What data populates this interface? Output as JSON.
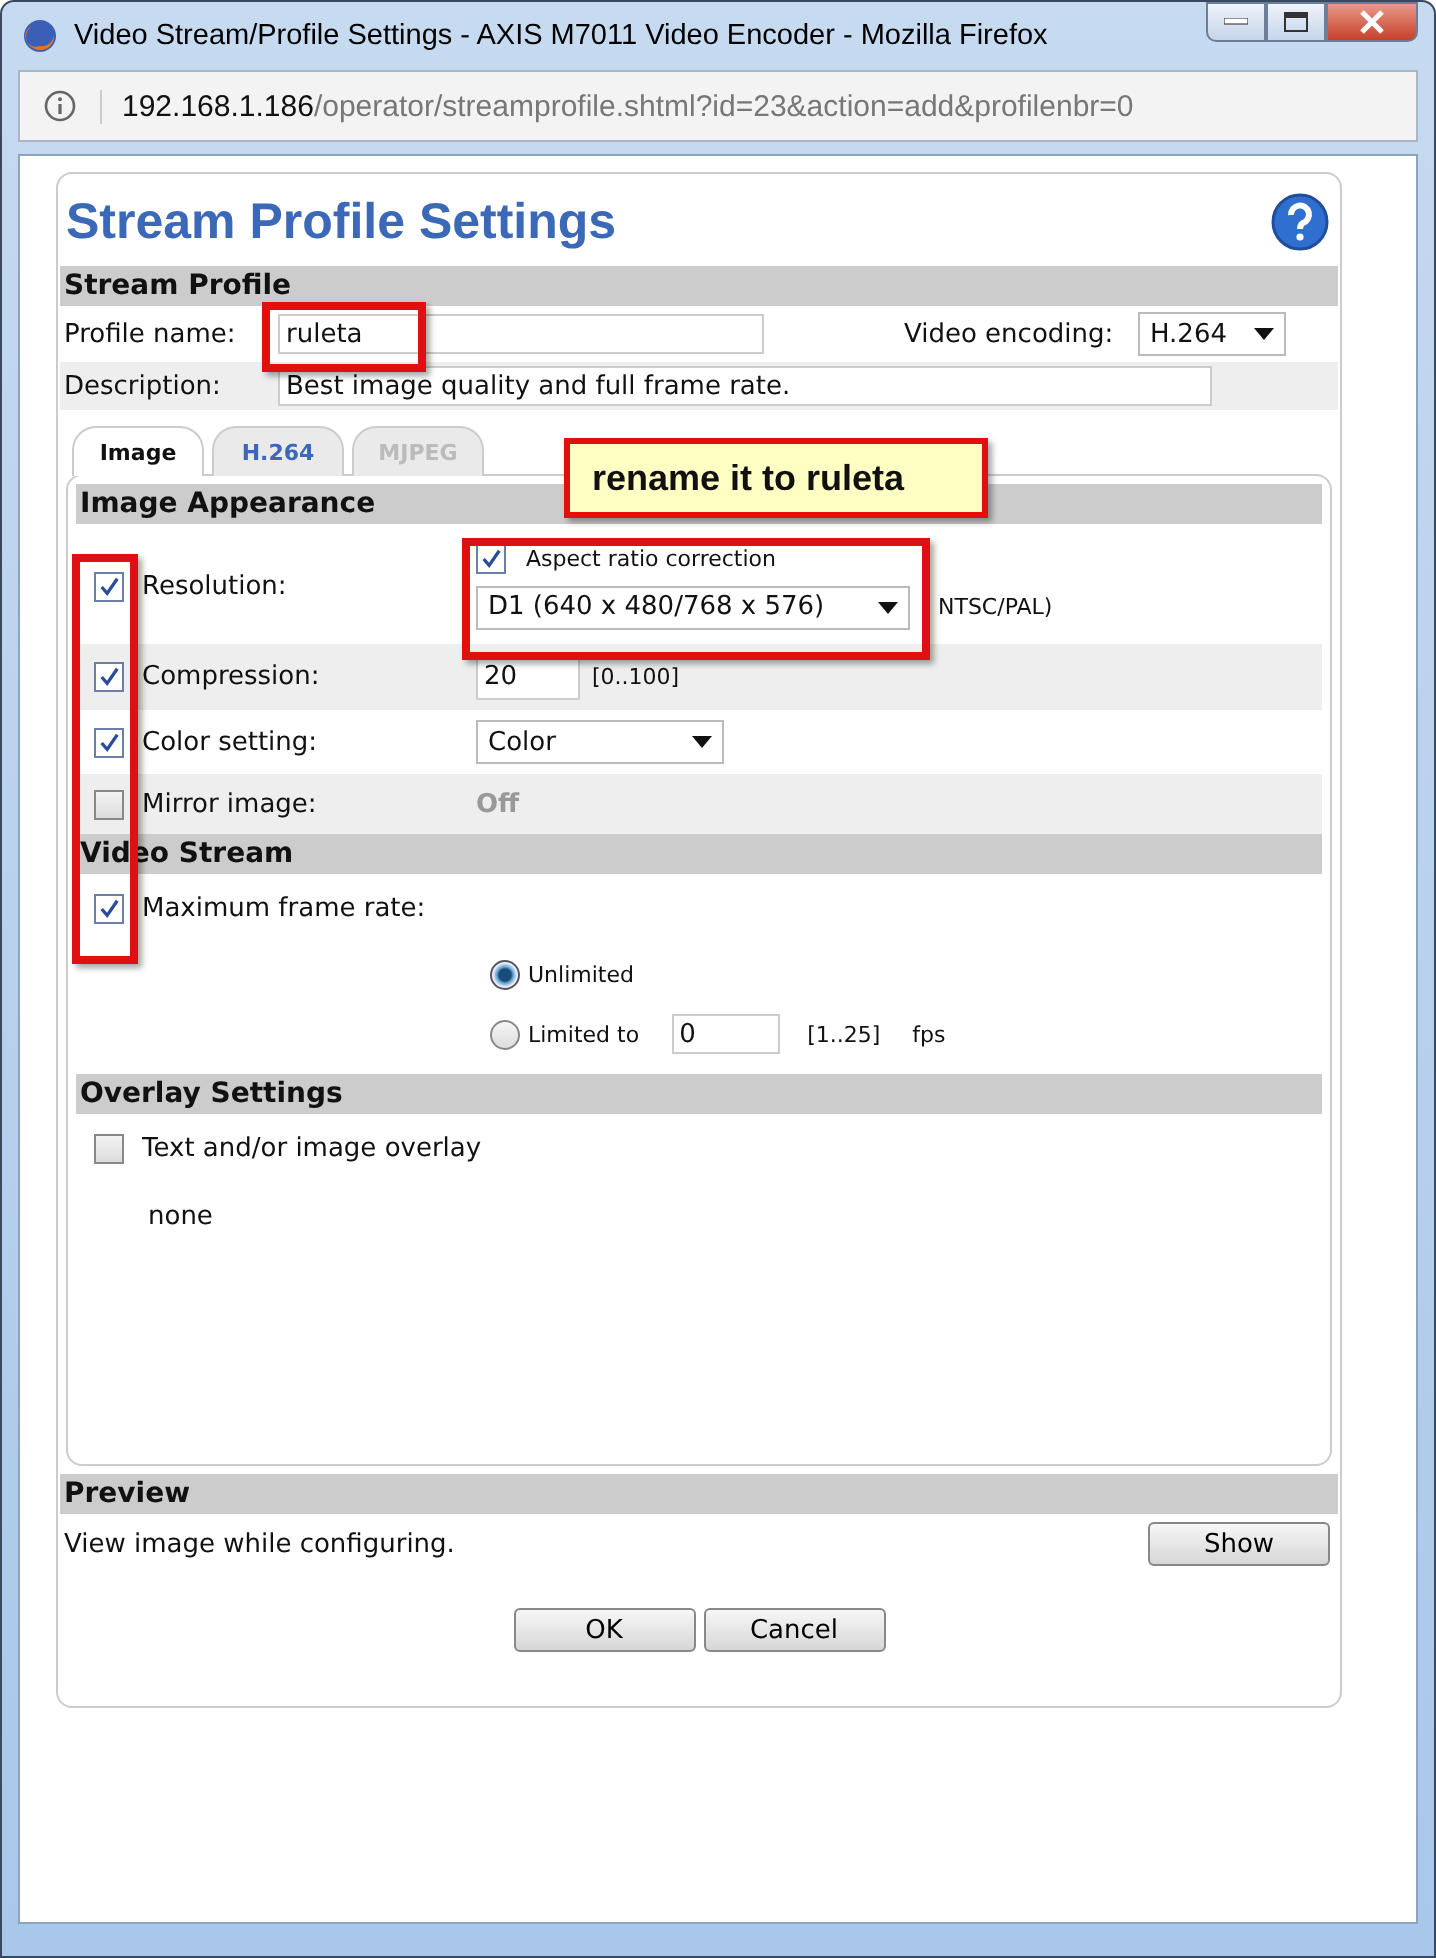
{
  "window": {
    "title": "Video Stream/Profile Settings - AXIS M7011 Video Encoder - Mozilla Firefox"
  },
  "address": {
    "host": "192.168.1.186",
    "path": "/operator/streamprofile.shtml?id=23&action=add&profilenbr=0"
  },
  "page": {
    "title": "Stream Profile Settings"
  },
  "stream_profile": {
    "heading": "Stream Profile",
    "profile_label": "Profile name:",
    "profile_value": "ruleta",
    "encoding_label": "Video encoding:",
    "encoding_value": "H.264",
    "description_label": "Description:",
    "description_value": "Best image quality and full frame rate."
  },
  "tabs": [
    {
      "label": "Image",
      "selected": true,
      "disabled": false
    },
    {
      "label": "H.264",
      "selected": false,
      "disabled": false
    },
    {
      "label": "MJPEG",
      "selected": false,
      "disabled": true
    }
  ],
  "callout": "rename it to ruleta",
  "image_appearance": {
    "heading": "Image Appearance",
    "rows": [
      {
        "kind": "resolution",
        "label": "Resolution:",
        "checked": true,
        "option_label": "Aspect ratio correction",
        "option_checked": true,
        "value": "D1 (640 x 480/768 x 576)",
        "note": "NTSC/PAL)"
      },
      {
        "kind": "number",
        "label": "Compression:",
        "checked": true,
        "value": "20",
        "note": "[0..100]"
      },
      {
        "kind": "select",
        "label": "Color setting:",
        "checked": true,
        "value": "Color"
      },
      {
        "kind": "readonly",
        "label": "Mirror image:",
        "checked": false,
        "value": "Off"
      }
    ]
  },
  "video_stream": {
    "heading": "Video Stream",
    "label": "Maximum frame rate:",
    "checked": true,
    "options": [
      {
        "label": "Unlimited",
        "selected": true
      },
      {
        "label": "Limited to",
        "selected": false,
        "value": "0",
        "range": "[1..25]",
        "unit": "fps"
      }
    ]
  },
  "overlay": {
    "heading": "Overlay Settings",
    "label": "Text and/or image overlay",
    "checked": false,
    "value": "none"
  },
  "preview": {
    "heading": "Preview",
    "text": "View image while configuring.",
    "button": "Show"
  },
  "buttons": [
    "OK",
    "Cancel"
  ]
}
